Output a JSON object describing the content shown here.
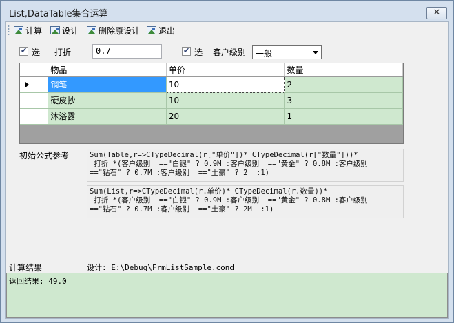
{
  "window": {
    "title": "List,DataTable集合运算",
    "close_glyph": "✕"
  },
  "toolbar": {
    "buttons": [
      {
        "label": "计算",
        "icon": "image-icon"
      },
      {
        "label": "设计",
        "icon": "image-icon"
      },
      {
        "label": "删除原设计",
        "icon": "image-icon"
      },
      {
        "label": "退出",
        "icon": "image-icon"
      }
    ]
  },
  "options": {
    "checkbox1": {
      "checked": true,
      "label": "选"
    },
    "discount": {
      "label": "打折",
      "value": "0.7"
    },
    "checkbox2": {
      "checked": true,
      "label": "选"
    },
    "customer_level": {
      "label": "客户级别",
      "value": "一般"
    }
  },
  "grid": {
    "columns": [
      "物品",
      "单价",
      "数量"
    ],
    "rows": [
      {
        "item": "钢笔",
        "price": "10",
        "qty": "2",
        "current": true
      },
      {
        "item": "硬皮抄",
        "price": "10",
        "qty": "3"
      },
      {
        "item": "沐浴露",
        "price": "20",
        "qty": "1"
      }
    ]
  },
  "formula": {
    "label": "初始公式参考",
    "table_formula": "Sum(Table,r=>CTypeDecimal(r[\"单价\"])* CTypeDecimal(r[\"数量\"]))*\n 打折 *(客户级别  ==\"白银\" ? 0.9M :客户级别  ==\"黄金\" ? 0.8M :客户级别\n==\"钻石\" ? 0.7M :客户级别  ==\"土豪\" ? 2  :1)",
    "list_formula": "Sum(List,r=>CTypeDecimal(r.单价)* CTypeDecimal(r.数量))*\n 打折 *(客户级别  ==\"白银\" ? 0.9M :客户级别  ==\"黄金\" ? 0.8M :客户级别\n==\"钻石\" ? 0.7M :客户级别  ==\"土豪\" ? 2M  :1)"
  },
  "result": {
    "label": "计算结果",
    "design_path": "设计: E:\\Debug\\FrmListSample.cond",
    "text": "返回结果: 49.0"
  },
  "colors": {
    "grid_cell": "#cfe8cf",
    "selection": "#3399ff",
    "window_frame": "#d4e0ee"
  }
}
